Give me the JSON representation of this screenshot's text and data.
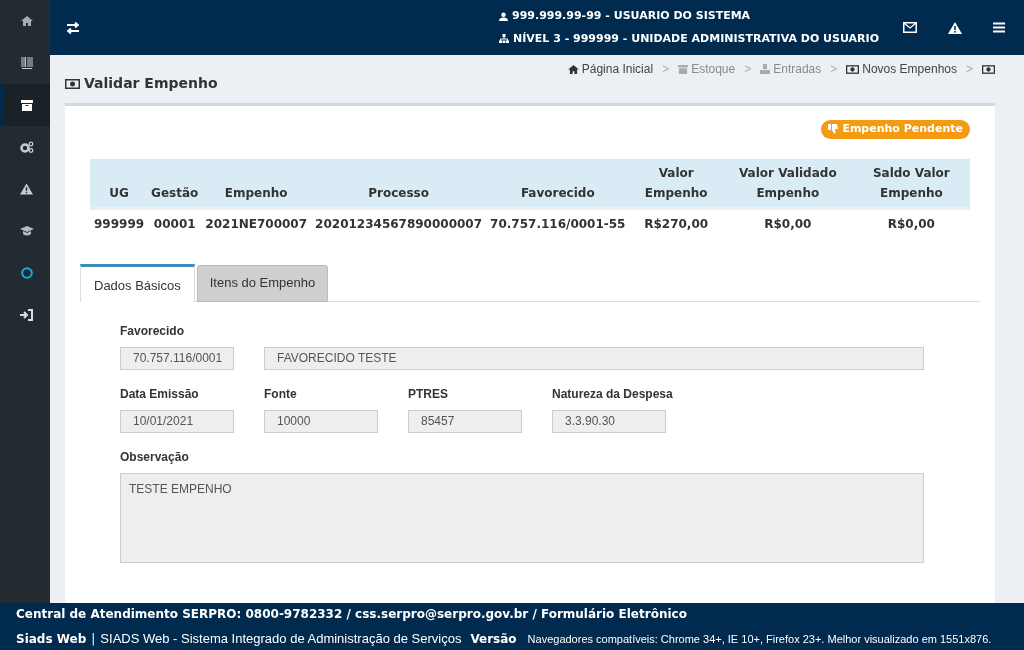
{
  "sidebar": {
    "items": [
      {
        "selected": false
      },
      {
        "selected": false
      },
      {
        "selected": true
      },
      {
        "selected": false
      },
      {
        "selected": false
      },
      {
        "selected": false
      },
      {
        "selected": false
      },
      {
        "selected": false
      }
    ]
  },
  "topbar": {
    "user": "999.999.99-99 - USUARIO DO SISTEMA",
    "unit": "NÍVEL 3 - 999999 - UNIDADE ADMINISTRATIVA DO USUARIO"
  },
  "page_title": "Validar Empenho",
  "breadcrumb": [
    {
      "kind": "link",
      "label": "Página Inicial",
      "disabled": false
    },
    {
      "kind": "link",
      "separator": ">",
      "label": "Estoque",
      "disabled": true
    },
    {
      "kind": "link",
      "separator": ">",
      "label": "Entradas",
      "disabled": true
    },
    {
      "kind": "link",
      "separator": ">",
      "label": "Novos Empenhos",
      "disabled": false
    },
    {
      "kind": "icon",
      "separator": ">",
      "disabled": false
    }
  ],
  "status_badge": "Empenho Pendente",
  "table": {
    "columns": [
      "UG",
      "Gestão",
      "Empenho",
      "Processo",
      "Favorecido",
      "Valor Empenho",
      "Valor Validado Empenho",
      "Saldo Valor Empenho"
    ],
    "rows": [
      [
        "999999",
        "00001",
        "2021NE700007",
        "20201234567890000007",
        "70.757.116/0001-55",
        "R$270,00",
        "R$0,00",
        "R$0,00"
      ]
    ]
  },
  "tabs": [
    {
      "label": "Dados Básicos",
      "selected": true
    },
    {
      "label": "Itens do Empenho",
      "selected": false
    }
  ],
  "form": {
    "favorecido": {
      "label": "Favorecido",
      "code": "70.757.116/0001",
      "name": "FAVORECIDO TESTE"
    },
    "row": [
      {
        "label": "Data Emissão",
        "value": "10/01/2021"
      },
      {
        "label": "Fonte",
        "value": "10000"
      },
      {
        "label": "PTRES",
        "value": "85457"
      },
      {
        "label": "Natureza da Despesa",
        "value": "3.3.90.30"
      }
    ],
    "observacao": {
      "label": "Observação",
      "value": "TESTE EMPENHO"
    }
  },
  "footer": {
    "contact": "Central de Atendimento SERPRO: 0800-9782332 / css.serpro@serpro.gov.br / Formulário Eletrônico",
    "app": "Siads Web",
    "separator": "|",
    "system": "SIADS Web - Sistema Integrado de Administração de Serviços",
    "version": "Versão",
    "browsers": "Navegadores compatíveis: Chrome 34+, IE 10+, Firefox 23+. Melhor visualizado em 1551x876."
  }
}
